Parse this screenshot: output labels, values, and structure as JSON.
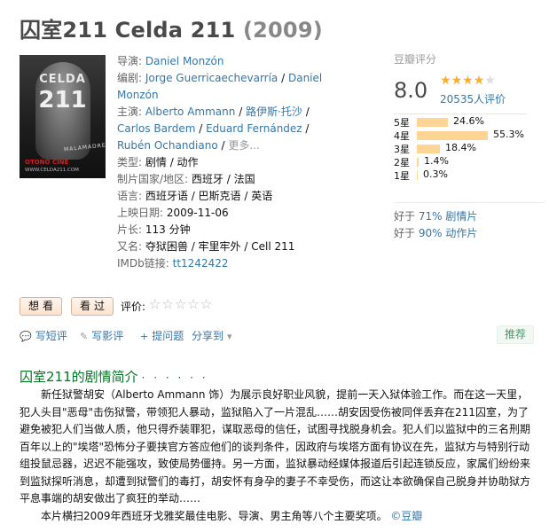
{
  "title": {
    "name": "囚室211 Celda 211",
    "year": "(2009)"
  },
  "poster": {
    "line1": "CELDA",
    "line2": "211",
    "alias": "MALAMADRE",
    "brand_prefix": "OTOÑO",
    "brand_suffix": "CINE",
    "url": "WWW.CELDA211.COM"
  },
  "info": {
    "director_label": "导演:",
    "director": "Daniel Monzón",
    "writer_label": "编剧:",
    "writers": [
      "Jorge Guerricaechevarría",
      "Daniel Monzón"
    ],
    "cast_label": "主演:",
    "cast": [
      "Alberto Ammann",
      "路伊斯·托沙",
      "Carlos Bardem",
      "Eduard Fernández",
      "Rubén Ochandiano"
    ],
    "more": "更多...",
    "genre_label": "类型:",
    "genre": "剧情 / 动作",
    "country_label": "制片国家/地区:",
    "country": "西班牙 / 法国",
    "language_label": "语言:",
    "language": "西班牙语 / 巴斯克语 / 英语",
    "release_label": "上映日期:",
    "release": "2009-11-06",
    "runtime_label": "片长:",
    "runtime": "113 分钟",
    "aka_label": "又名:",
    "aka": "夺狱困兽 / 牢里牢外 / Cell 211",
    "imdb_label": "IMDb链接:",
    "imdb": "tt1242422"
  },
  "rating": {
    "label": "豆瓣评分",
    "score": "8.0",
    "stars_filled": 4,
    "stars_total": 5,
    "votes": "20535人评价",
    "distribution": [
      {
        "label": "5星",
        "percent": 24.6,
        "text": "24.6%"
      },
      {
        "label": "4星",
        "percent": 55.3,
        "text": "55.3%"
      },
      {
        "label": "3星",
        "percent": 18.4,
        "text": "18.4%"
      },
      {
        "label": "2星",
        "percent": 1.4,
        "text": "1.4%"
      },
      {
        "label": "1星",
        "percent": 0.3,
        "text": "0.3%"
      }
    ],
    "better_than": [
      {
        "prefix": "好于 ",
        "value": "71% 剧情片"
      },
      {
        "prefix": "好于 ",
        "value": "90% 动作片"
      }
    ]
  },
  "actions": {
    "want": "想看",
    "seen": "看过",
    "rate_label": "评价:",
    "rate_stars": "☆☆☆☆☆"
  },
  "tools": {
    "write_review": "写短评",
    "write_long_review": "写影评",
    "ask": "提问题",
    "share": "分享到",
    "recommend": "推荐"
  },
  "summary": {
    "title": "囚室211的剧情简介",
    "dots": "· · · · · ·",
    "paragraph1": "新任狱警胡安（Alberto Ammann 饰）为展示良好职业风貌，提前一天入狱体验工作。而在这一天里，犯人头目\"恶母\"击伤狱警，带领犯人暴动，监狱陷入了一片混乱……胡安因受伤被同伴丢弃在211囚室，为了避免被犯人们当做人质，他只得乔装罪犯，谋取恶母的信任，试图寻找脱身机会。犯人们以监狱中的三名刑期百年以上的\"埃塔\"恐怖分子要挟官方答应他们的谈判条件，因政府与埃塔方面有协议在先，监狱方与特别行动组投鼠忌器，迟迟不能强攻，致使局势僵持。另一方面，监狱暴动经媒体报道后引起连锁反应，家属们纷纷来到监狱探听消息，却遭到狱警们的毒打，胡安怀有身孕的妻子不幸受伤，而这让本欲确保自己脱身并协助狱方平息事端的胡安做出了疯狂的举动……",
    "paragraph2": "本片横扫2009年西班牙戈雅奖最佳电影、导演、男主角等八个主要奖项。",
    "source": "©豆瓣"
  }
}
